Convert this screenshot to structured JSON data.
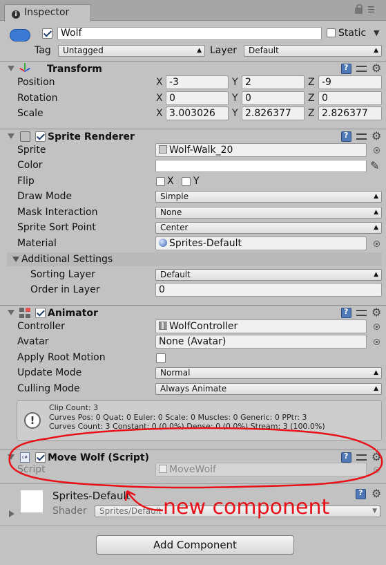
{
  "tab": {
    "title": "Inspector"
  },
  "object": {
    "name": "Wolf",
    "static_label": "Static",
    "tag_label": "Tag",
    "tag_value": "Untagged",
    "layer_label": "Layer",
    "layer_value": "Default"
  },
  "transform": {
    "title": "Transform",
    "rows": [
      {
        "label": "Position",
        "x": "-3",
        "y": "2",
        "z": "-9"
      },
      {
        "label": "Rotation",
        "x": "0",
        "y": "0",
        "z": "0"
      },
      {
        "label": "Scale",
        "x": "3.003026",
        "y": "2.826377",
        "z": "2.826377"
      }
    ],
    "axes": {
      "x": "X",
      "y": "Y",
      "z": "Z"
    }
  },
  "sprite_renderer": {
    "title": "Sprite Renderer",
    "sprite_label": "Sprite",
    "sprite_value": "Wolf-Walk_20",
    "color_label": "Color",
    "flip_label": "Flip",
    "flip_x": "X",
    "flip_y": "Y",
    "draw_mode_label": "Draw Mode",
    "draw_mode_value": "Simple",
    "mask_label": "Mask Interaction",
    "mask_value": "None",
    "sort_point_label": "Sprite Sort Point",
    "sort_point_value": "Center",
    "material_label": "Material",
    "material_value": "Sprites-Default",
    "additional_label": "Additional Settings",
    "sorting_layer_label": "Sorting Layer",
    "sorting_layer_value": "Default",
    "order_label": "Order in Layer",
    "order_value": "0"
  },
  "animator": {
    "title": "Animator",
    "controller_label": "Controller",
    "controller_value": "WolfController",
    "avatar_label": "Avatar",
    "avatar_value": "None (Avatar)",
    "root_motion_label": "Apply Root Motion",
    "update_mode_label": "Update Mode",
    "update_mode_value": "Normal",
    "culling_label": "Culling Mode",
    "culling_value": "Always Animate",
    "info_lines": [
      "Clip Count: 3",
      "Curves Pos: 0 Quat: 0 Euler: 0 Scale: 0 Muscles: 0 Generic: 0 PPtr: 3",
      "Curves Count: 3 Constant: 0 (0.0%) Dense: 0 (0.0%) Stream: 3 (100.0%)"
    ]
  },
  "move_wolf": {
    "title": "Move Wolf (Script)",
    "script_label": "Script",
    "script_value": "MoveWolf"
  },
  "material": {
    "name": "Sprites-Default",
    "shader_label": "Shader",
    "shader_value": "Sprites/Default"
  },
  "add_component_label": "Add Component",
  "annotation": {
    "text": "new component",
    "color": "#e8111a"
  }
}
